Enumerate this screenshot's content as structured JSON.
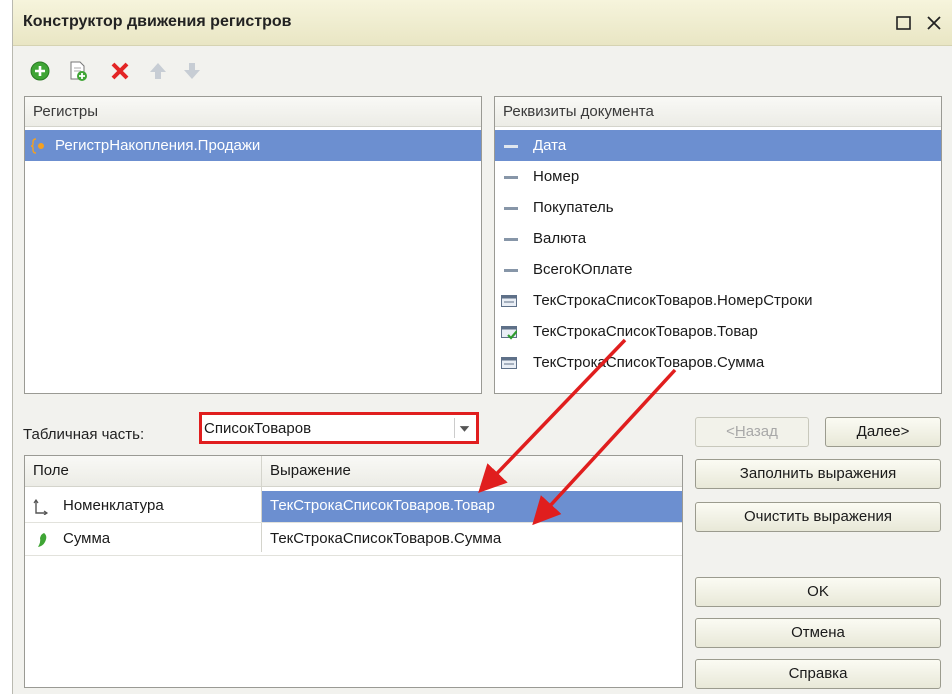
{
  "window": {
    "title": "Конструктор движения регистров",
    "controls": [
      "maximize-icon",
      "close-icon"
    ]
  },
  "toolbar": {
    "buttons": [
      "add-icon",
      "copy-icon",
      "delete-icon",
      "move-up-icon",
      "move-down-icon"
    ]
  },
  "registers_panel": {
    "header": "Регистры",
    "items": [
      {
        "label": "РегистрНакопления.Продажи",
        "icon": "accumulation-register-icon",
        "selected": true
      }
    ]
  },
  "attributes_panel": {
    "header": "Реквизиты документа",
    "items": [
      {
        "label": "Дата",
        "icon": "attribute-icon",
        "selected": true
      },
      {
        "label": "Номер",
        "icon": "attribute-icon"
      },
      {
        "label": "Покупатель",
        "icon": "attribute-icon"
      },
      {
        "label": "Валюта",
        "icon": "attribute-icon"
      },
      {
        "label": "ВсегоКОплате",
        "icon": "attribute-icon"
      },
      {
        "label": "ТекСтрокаСписокТоваров.НомерСтроки",
        "icon": "table-field-icon"
      },
      {
        "label": "ТекСтрокаСписокТоваров.Товар",
        "icon": "table-field-checked-icon"
      },
      {
        "label": "ТекСтрокаСписокТоваров.Сумма",
        "icon": "table-field-icon"
      }
    ]
  },
  "tabular_part": {
    "label": "Табличная часть:",
    "value": "СписокТоваров"
  },
  "nav": {
    "back_label": "<Назад",
    "back_hotkey": "Н",
    "next_label": "Далее>",
    "next_hotkey": "Д"
  },
  "fields_grid": {
    "columns": [
      "Поле",
      "Выражение"
    ],
    "rows": [
      {
        "field": "Номенклатура",
        "expression": "ТекСтрокаСписокТоваров.Товар",
        "icon": "dimension-icon",
        "selected": true
      },
      {
        "field": "Сумма",
        "expression": "ТекСтрокаСписокТоваров.Сумма",
        "icon": "resource-icon"
      }
    ]
  },
  "side_buttons": {
    "fill_label": "Заполнить выражения",
    "clear_label": "Очистить выражения",
    "ok_label": "OK",
    "cancel_label": "Отмена",
    "help_label": "Справка"
  },
  "colors": {
    "selection": "#6c8fd0",
    "highlight_border": "#e01e1e",
    "annotation_arrow": "#e01e1e"
  }
}
